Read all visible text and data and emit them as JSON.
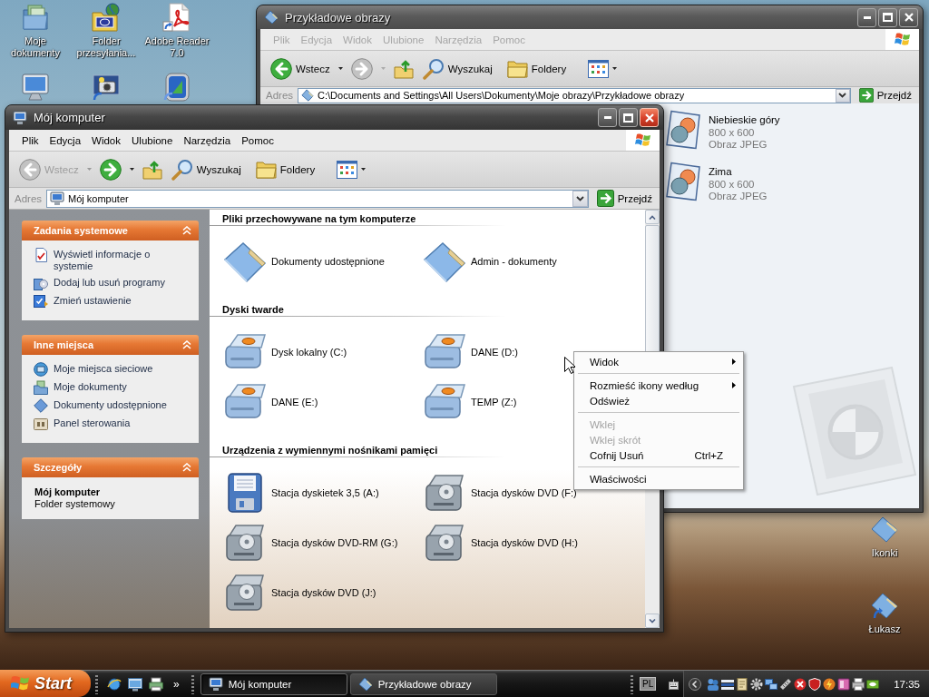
{
  "desktop_icons": [
    {
      "label": "Moje dokumenty",
      "kind": "documents"
    },
    {
      "label": "Folder przesyłania...",
      "kind": "globe-folder"
    },
    {
      "label": "Adobe Reader 7.0",
      "kind": "pdf"
    },
    {
      "kind": "monitor"
    },
    {
      "kind": "camera"
    },
    {
      "kind": "app"
    }
  ],
  "desktop_icons_right": [
    {
      "label": "Ikonki",
      "kind": "folder"
    },
    {
      "label": "Łukasz",
      "kind": "folder-shortcut"
    }
  ],
  "windows": [
    {
      "kind": "pictures",
      "active": false,
      "title": "Przykładowe obrazy",
      "menu": [
        "Plik",
        "Edycja",
        "Widok",
        "Ulubione",
        "Narzędzia",
        "Pomoc"
      ],
      "toolbar": {
        "back": {
          "label": "Wstecz",
          "disabled": false
        },
        "forward": {
          "disabled": true
        },
        "search": "Wyszukaj",
        "folders": "Foldery"
      },
      "address": {
        "label": "Adres",
        "value": "C:\\Documents and Settings\\All Users\\Dokumenty\\Moje obrazy\\Przykładowe obrazy",
        "go": "Przejdź"
      },
      "files": [
        {
          "name": "Niebieskie góry",
          "dimensions": "800 x 600",
          "type": "Obraz JPEG"
        },
        {
          "name": "Zima",
          "dimensions": "800 x 600",
          "type": "Obraz JPEG"
        }
      ]
    },
    {
      "kind": "computer",
      "active": true,
      "title": "Mój komputer",
      "menu": [
        "Plik",
        "Edycja",
        "Widok",
        "Ulubione",
        "Narzędzia",
        "Pomoc"
      ],
      "toolbar": {
        "back": {
          "label": "Wstecz",
          "disabled": true
        },
        "forward": {
          "disabled": false
        },
        "search": "Wyszukaj",
        "folders": "Foldery"
      },
      "address": {
        "label": "Adres",
        "value": "Mój komputer",
        "go": "Przejdź"
      },
      "task_groups": [
        {
          "title": "Zadania systemowe",
          "expanded": true,
          "kind": "links",
          "links": [
            {
              "label": "Wyświetl informacje o systemie",
              "kind": "system-info"
            },
            {
              "label": "Dodaj lub usuń programy",
              "kind": "programs"
            },
            {
              "label": "Zmień ustawienie",
              "kind": "settings"
            }
          ]
        },
        {
          "title": "Inne miejsca",
          "expanded": true,
          "kind": "links",
          "links": [
            {
              "label": "Moje miejsca sieciowe",
              "kind": "network"
            },
            {
              "label": "Moje dokumenty",
              "kind": "documents"
            },
            {
              "label": "Dokumenty udostępnione",
              "kind": "shared"
            },
            {
              "label": "Panel sterowania",
              "kind": "control-panel"
            }
          ]
        },
        {
          "title": "Szczegóły",
          "expanded": true,
          "kind": "details",
          "name": "Mój komputer",
          "description": "Folder systemowy"
        }
      ],
      "sections": [
        {
          "title": "Pliki przechowywane na tym komputerze",
          "items": [
            {
              "label": "Dokumenty udostępnione",
              "kind": "folder"
            },
            {
              "label": "Admin - dokumenty",
              "kind": "folder"
            }
          ]
        },
        {
          "title": "Dyski twarde",
          "items": [
            {
              "label": "Dysk lokalny (C:)",
              "kind": "hdd"
            },
            {
              "label": "DANE (D:)",
              "kind": "hdd"
            },
            {
              "label": "DANE (E:)",
              "kind": "hdd"
            },
            {
              "label": "TEMP (Z:)",
              "kind": "hdd"
            }
          ]
        },
        {
          "title": "Urządzenia z wymiennymi nośnikami pamięci",
          "items": [
            {
              "label": "Stacja dyskietek 3,5 (A:)",
              "kind": "floppy"
            },
            {
              "label": "Stacja dysków DVD (F:)",
              "kind": "dvd"
            },
            {
              "label": "Stacja dysków DVD-RM (G:)",
              "kind": "dvd"
            },
            {
              "label": "Stacja dysków DVD (H:)",
              "kind": "dvd"
            },
            {
              "label": "Stacja dysków DVD (J:)",
              "kind": "dvd"
            }
          ]
        }
      ]
    }
  ],
  "context_menu": {
    "items": [
      {
        "kind": "item",
        "label": "Widok",
        "submenu": true,
        "disabled": false
      },
      {
        "kind": "separator"
      },
      {
        "kind": "item",
        "label": "Rozmieść ikony według",
        "submenu": true,
        "disabled": false
      },
      {
        "kind": "item",
        "label": "Odśwież",
        "submenu": false,
        "disabled": false
      },
      {
        "kind": "separator"
      },
      {
        "kind": "item",
        "label": "Wklej",
        "submenu": false,
        "disabled": true
      },
      {
        "kind": "item",
        "label": "Wklej skrót",
        "submenu": false,
        "disabled": true
      },
      {
        "kind": "item",
        "label": "Cofnij Usuń",
        "shortcut": "Ctrl+Z",
        "submenu": false,
        "disabled": false
      },
      {
        "kind": "separator"
      },
      {
        "kind": "item",
        "label": "Właściwości",
        "submenu": false,
        "disabled": false
      }
    ]
  },
  "taskbar": {
    "start": "Start",
    "more": "»",
    "tasks": [
      {
        "label": "Mój komputer",
        "kind": "computer",
        "selected": true
      },
      {
        "label": "Przykładowe obrazy",
        "kind": "folder",
        "selected": false
      }
    ],
    "language": "PL",
    "clock": "17:35"
  }
}
